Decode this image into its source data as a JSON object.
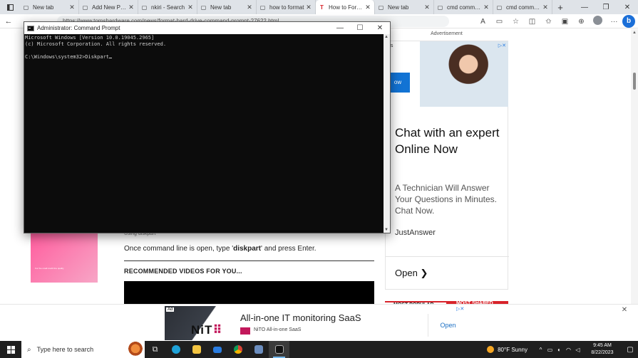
{
  "browser": {
    "tabs": [
      {
        "title": "New tab",
        "active": false
      },
      {
        "title": "Add New Post",
        "active": false
      },
      {
        "title": "nkiri - Search",
        "active": false
      },
      {
        "title": "New tab",
        "active": false
      },
      {
        "title": "how to format",
        "active": false
      },
      {
        "title": "How to Format",
        "active": true
      },
      {
        "title": "New tab",
        "active": false
      },
      {
        "title": "cmd command",
        "active": false
      },
      {
        "title": "cmd command",
        "active": false
      }
    ],
    "address": "https://www.tomshardware.com/news/format-hard-drive-command-prompt-27622.html"
  },
  "cmd": {
    "title": "Administrator: Command Prompt",
    "lines": [
      "Microsoft Windows [Version 10.0.19045.2965]",
      "(c) Microsoft Corporation. All rights reserved.",
      "",
      "C:\\Windows\\system32>Diskpart"
    ]
  },
  "article": {
    "caption": "Using diskpart",
    "instruction_before": "Once command line is open, type '",
    "instruction_command": "diskpart",
    "instruction_after": "' and press Enter.",
    "section_title": "RECOMMENDED VIDEOS FOR YOU...",
    "thumb_text": "For the small credit line quality"
  },
  "side_ad": {
    "label": "Advertisement",
    "cut_text": "as",
    "button_text": "ow",
    "headline": "Chat with an expert Online Now",
    "subtext": "A Technician Will Answer Your Questions in Minutes. Chat Now.",
    "brand": "JustAnswer",
    "cta": "Open",
    "tab_popular": "MOST POPULAR",
    "tab_shared": "MOST SHARED"
  },
  "bottom_ad": {
    "badge": "Ad",
    "logo": "NiT",
    "title": "All-in-one IT monitoring SaaS",
    "subtitle": "NiTO All-in-one SaaS",
    "cta": "Open"
  },
  "taskbar": {
    "search_placeholder": "Type here to search",
    "weather": "80°F  Sunny",
    "time": "9:45 AM",
    "date": "8/22/2023"
  }
}
